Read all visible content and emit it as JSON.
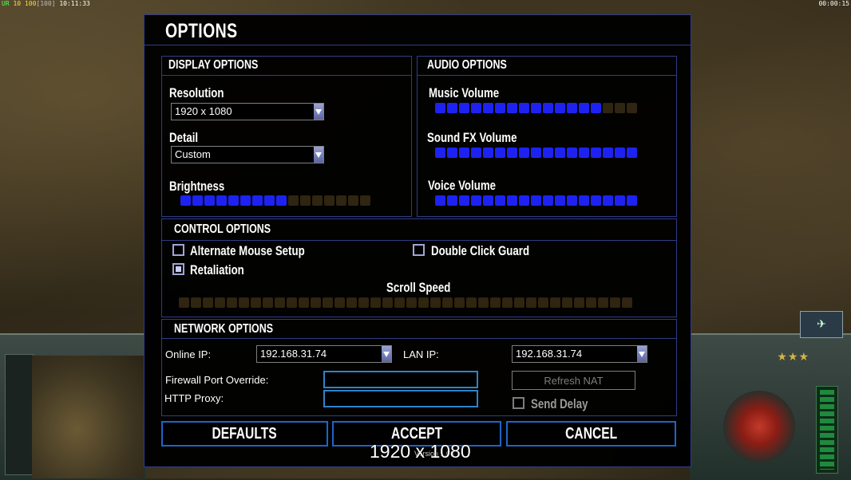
{
  "hud": {
    "debug_top_left": [
      "UR",
      "10",
      "100",
      "[100]",
      "10:11:33"
    ],
    "debug_top_right": "00:00:15",
    "rank_stars": "★★★"
  },
  "dialog": {
    "title": "OPTIONS",
    "display": {
      "title": "DISPLAY OPTIONS",
      "resolution_label": "Resolution",
      "resolution_value": "1920 x 1080",
      "detail_label": "Detail",
      "detail_value": "Custom",
      "brightness_label": "Brightness",
      "brightness_level": {
        "filled": 9,
        "total": 16
      }
    },
    "audio": {
      "title": "AUDIO OPTIONS",
      "music_label": "Music Volume",
      "music_level": {
        "filled": 14,
        "total": 17
      },
      "sfx_label": "Sound FX Volume",
      "sfx_level": {
        "filled": 17,
        "total": 17
      },
      "voice_label": "Voice Volume",
      "voice_level": {
        "filled": 17,
        "total": 17
      }
    },
    "control": {
      "title": "CONTROL OPTIONS",
      "alternate_mouse_label": "Alternate Mouse Setup",
      "alternate_mouse_checked": false,
      "double_click_label": "Double Click Guard",
      "double_click_checked": false,
      "retaliation_label": "Retaliation",
      "retaliation_checked": true,
      "scroll_speed_label": "Scroll Speed",
      "scroll_speed_level": {
        "filled": 0,
        "total": 38
      }
    },
    "network": {
      "title": "NETWORK OPTIONS",
      "online_ip_label": "Online IP:",
      "online_ip_value": "192.168.31.74",
      "lan_ip_label": "LAN IP:",
      "lan_ip_value": "192.168.31.74",
      "firewall_label": "Firewall Port Override:",
      "firewall_value": "",
      "http_proxy_label": "HTTP Proxy:",
      "http_proxy_value": "",
      "refresh_nat_label": "Refresh NAT",
      "send_delay_label": "Send Delay",
      "send_delay_checked": false
    },
    "buttons": {
      "defaults": "DEFAULTS",
      "accept": "ACCEPT",
      "cancel": "CANCEL"
    },
    "version_text": "Version 1.06"
  },
  "overlay_resolution": "1920 x 1080",
  "colors": {
    "border": "#2f3d86",
    "bar_on": "#1d22f0",
    "bar_off": "#2f2510",
    "button_border": "#1f64c8"
  }
}
